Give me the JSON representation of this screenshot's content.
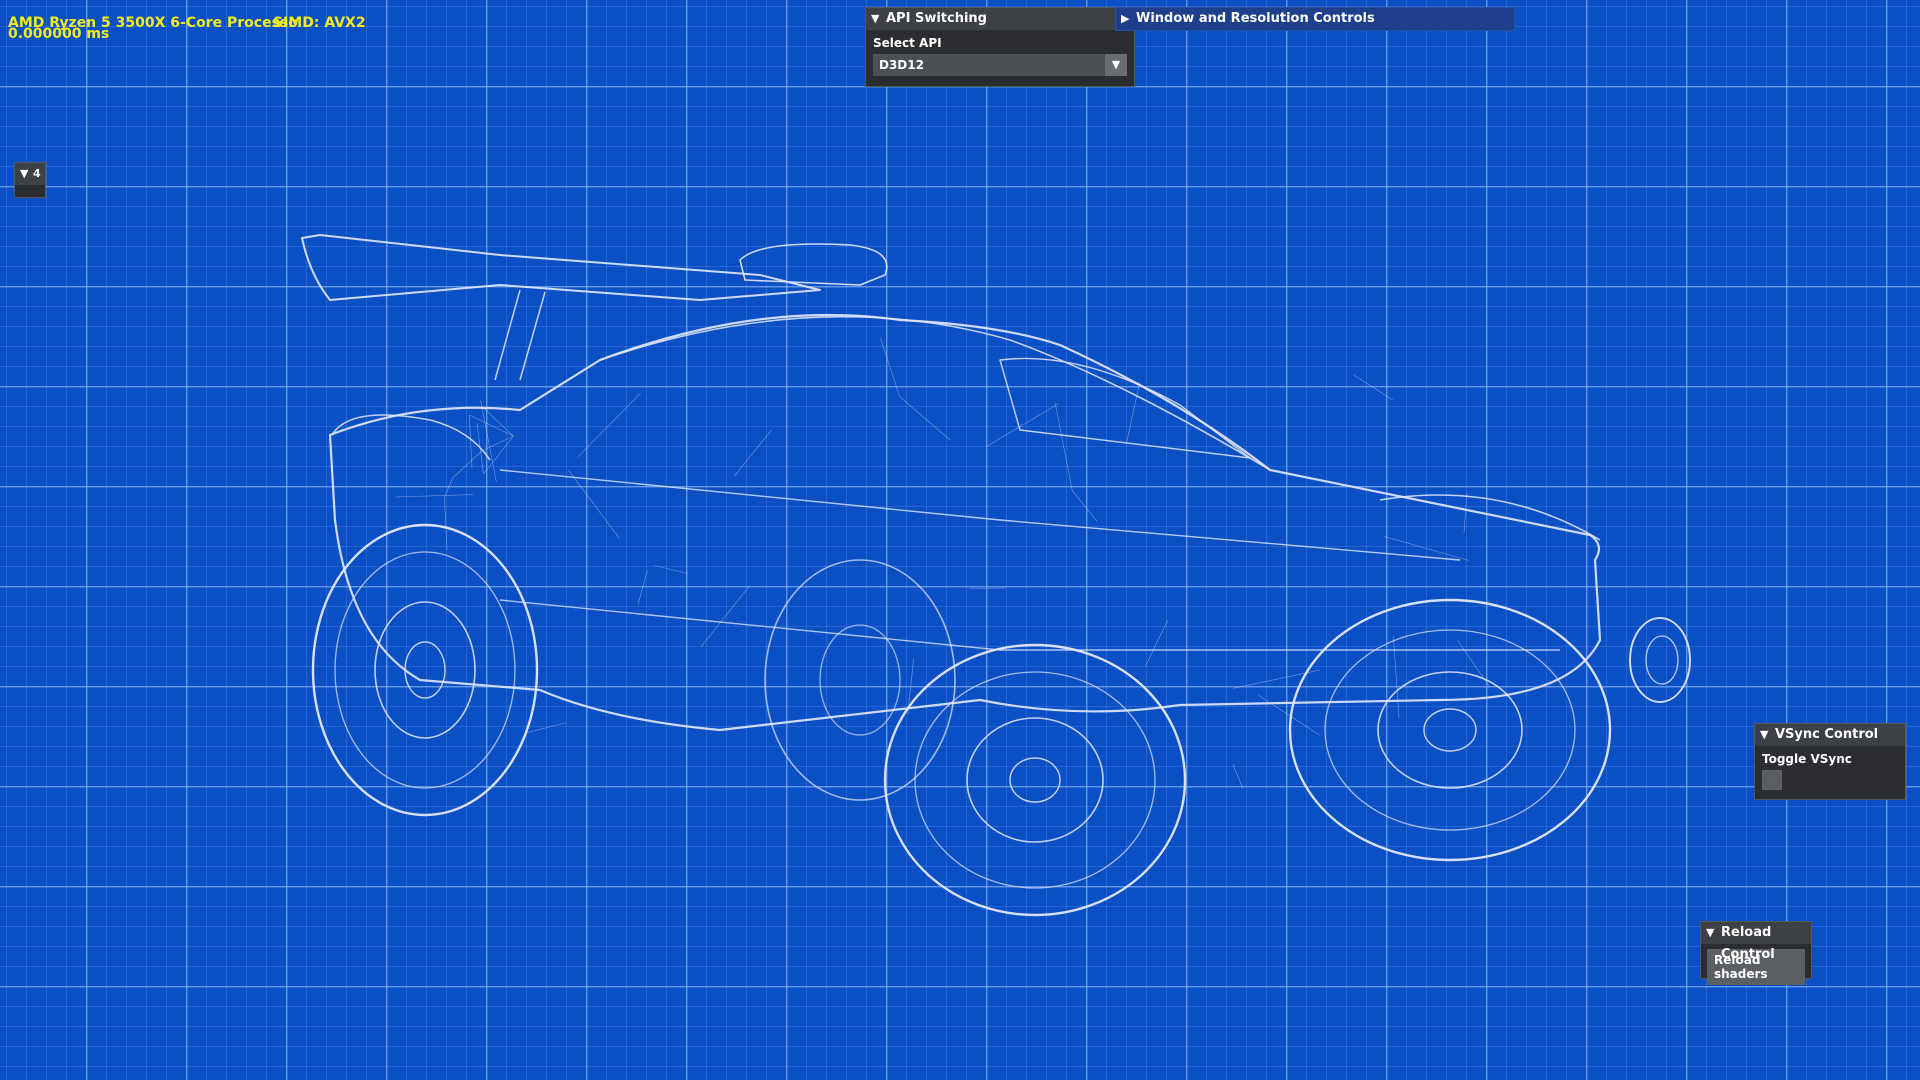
{
  "hud": {
    "cpu": "AMD Ryzen 5 3500X 6-Core Processo",
    "simd": "SIMD: AVX2",
    "frame_time": "0.000000 ms"
  },
  "collapsed_panel": {
    "label": "4",
    "icon": "triangle-down-icon"
  },
  "api_panel": {
    "title": "API Switching",
    "select_label": "Select API",
    "selected_value": "D3D12"
  },
  "window_panel": {
    "title": "Window and Resolution Controls"
  },
  "vsync_panel": {
    "title": "VSync Control",
    "toggle_label": "Toggle VSync",
    "checked": false
  },
  "reload_panel": {
    "title": "Reload Control",
    "button_label": "Reload shaders"
  },
  "colors": {
    "background": "#0b4fc4",
    "wireframe": "#e4e8ff",
    "hud_text": "#f2ec1c",
    "panel_bg": "#2b2d30",
    "panel_header_active": "#1d3f8c"
  }
}
